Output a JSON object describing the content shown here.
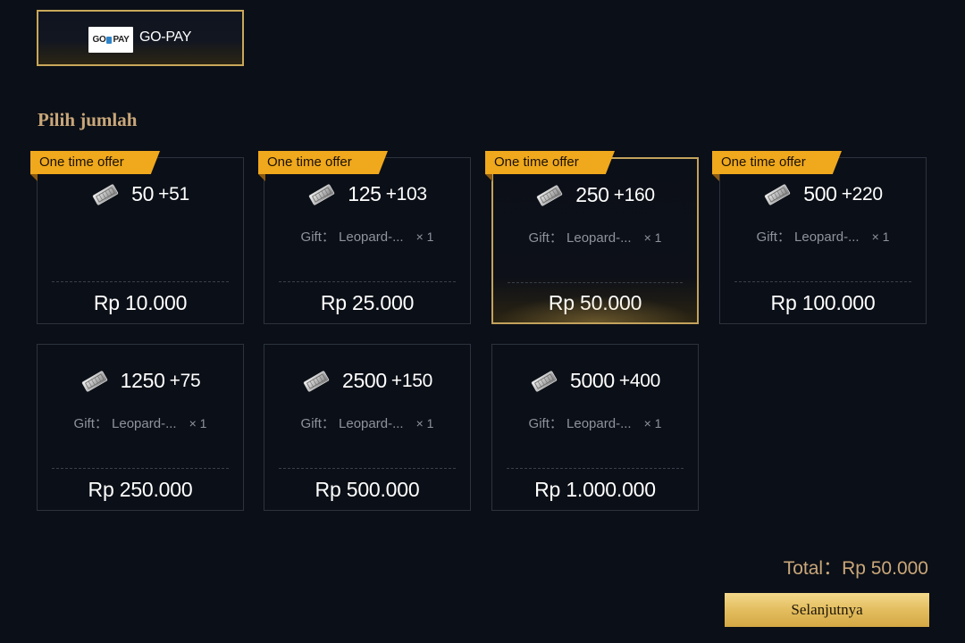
{
  "payment": {
    "logo_left": "GO",
    "logo_right": "PAY",
    "label": "GO-PAY"
  },
  "section_title": "Pilih jumlah",
  "packages": [
    {
      "ribbon": "One time offer",
      "amount": "50",
      "bonus": "+51",
      "gift": "",
      "qty": "",
      "price": "Rp 10.000",
      "selected": false
    },
    {
      "ribbon": "One time offer",
      "amount": "125",
      "bonus": "+103",
      "gift": "Gift： Leopard-...",
      "qty": "× 1",
      "price": "Rp 25.000",
      "selected": false
    },
    {
      "ribbon": "One time offer",
      "amount": "250",
      "bonus": "+160",
      "gift": "Gift： Leopard-...",
      "qty": "× 1",
      "price": "Rp 50.000",
      "selected": true
    },
    {
      "ribbon": "One time offer",
      "amount": "500",
      "bonus": "+220",
      "gift": "Gift： Leopard-...",
      "qty": "× 1",
      "price": "Rp 100.000",
      "selected": false
    },
    {
      "ribbon": "",
      "amount": "1250",
      "bonus": "+75",
      "gift": "Gift： Leopard-...",
      "qty": "× 1",
      "price": "Rp 250.000",
      "selected": false
    },
    {
      "ribbon": "",
      "amount": "2500",
      "bonus": "+150",
      "gift": "Gift： Leopard-...",
      "qty": "× 1",
      "price": "Rp 500.000",
      "selected": false
    },
    {
      "ribbon": "",
      "amount": "5000",
      "bonus": "+400",
      "gift": "Gift： Leopard-...",
      "qty": "× 1",
      "price": "Rp 1.000.000",
      "selected": false
    }
  ],
  "total": {
    "label": "Total：",
    "value": "Rp 50.000"
  },
  "next_button": "Selanjutnya",
  "colors": {
    "background": "#0b0f17",
    "gold": "#c9a77a",
    "ribbon": "#f0a81c",
    "button": "#e3bd5f"
  },
  "icons": {
    "package": "silver-coupon-icon"
  }
}
